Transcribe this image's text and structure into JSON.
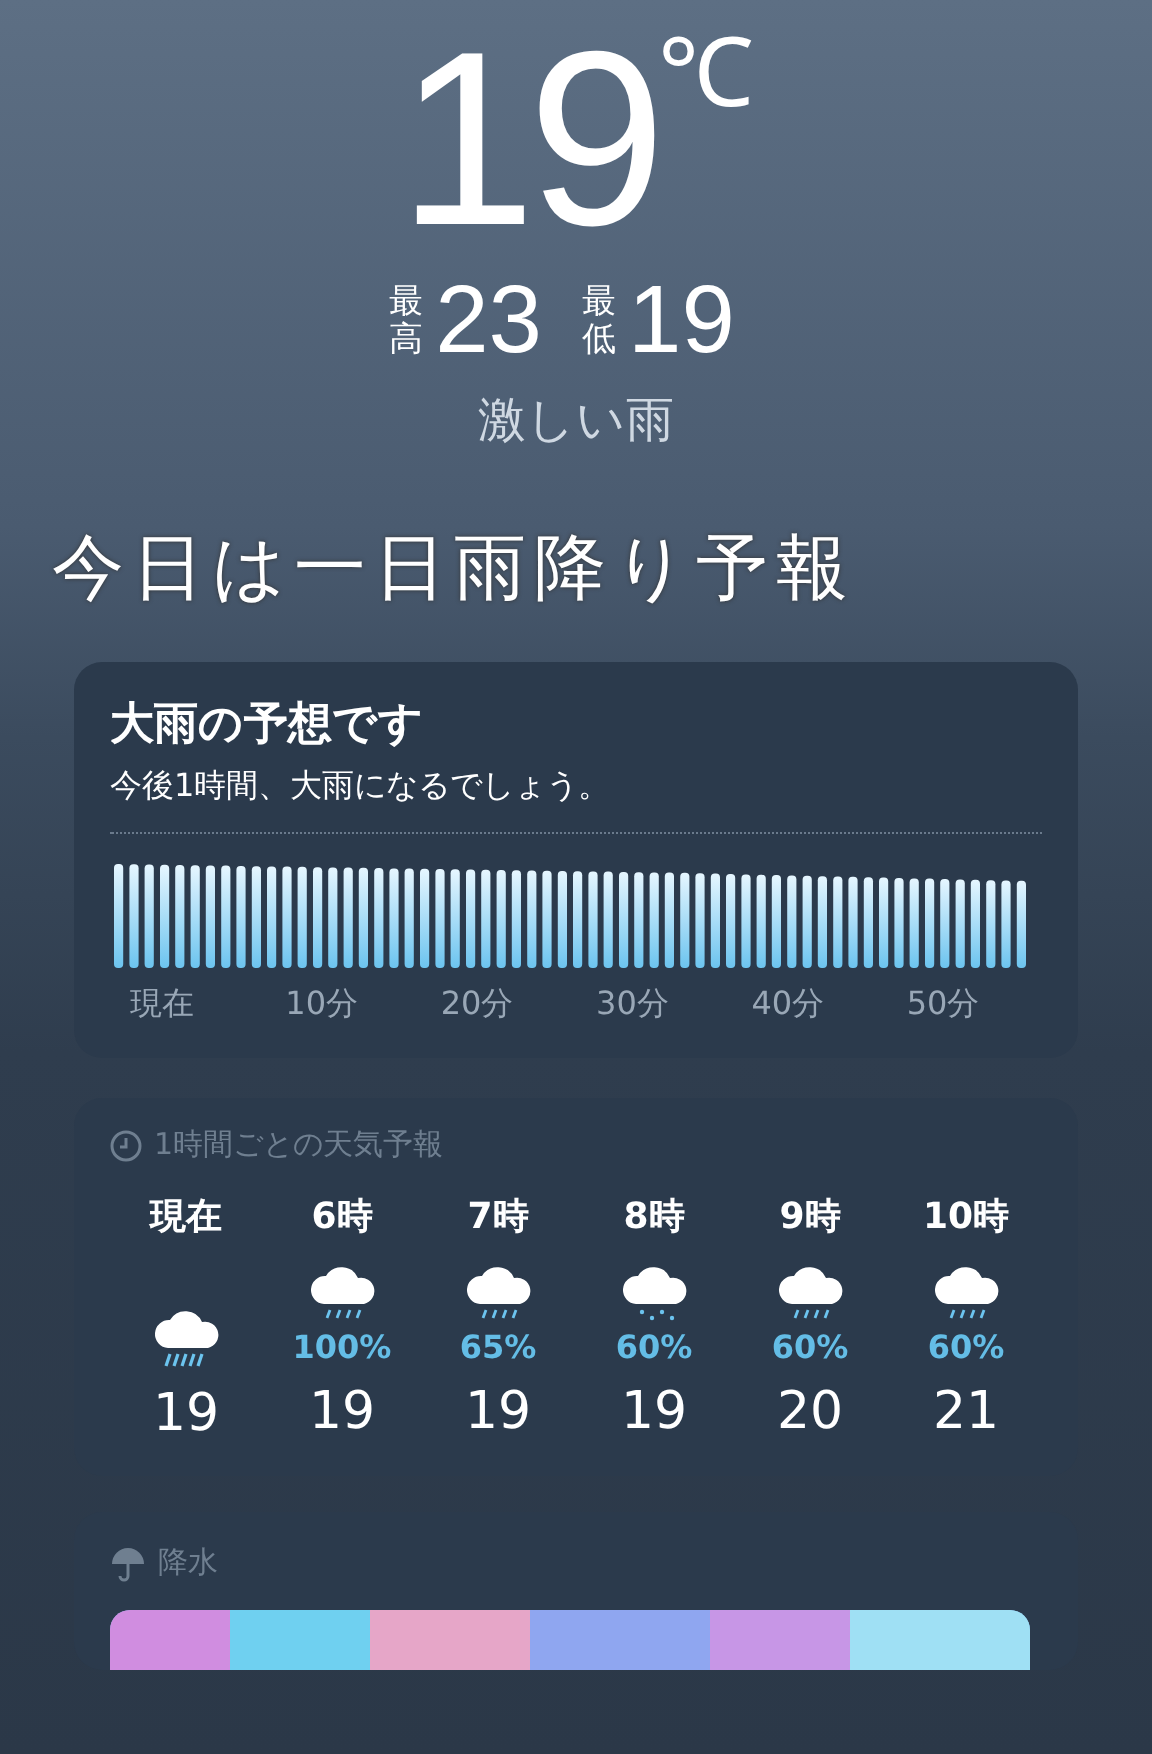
{
  "current": {
    "temperature": "19",
    "unit": "℃",
    "high_label": "最高",
    "high": "23",
    "low_label": "最低",
    "low": "19",
    "condition": "激しい雨"
  },
  "caption": "今日は一日雨降り予報",
  "next_hour": {
    "title": "大雨の予想です",
    "summary": "今後1時間、大雨になるでしょう。",
    "axis": [
      "現在",
      "10分",
      "20分",
      "30分",
      "40分",
      "50分"
    ]
  },
  "hourly": {
    "title": "1時間ごとの天気予報",
    "hours": [
      {
        "time": "現在",
        "kind": "heavy",
        "temp": "19"
      },
      {
        "time": "6時",
        "kind": "rain",
        "chance": "100%",
        "temp": "19"
      },
      {
        "time": "7時",
        "kind": "rain",
        "chance": "65%",
        "temp": "19"
      },
      {
        "time": "8時",
        "kind": "drizzle",
        "chance": "60%",
        "temp": "19"
      },
      {
        "time": "9時",
        "kind": "rain",
        "chance": "60%",
        "temp": "20"
      },
      {
        "time": "10時",
        "kind": "rain",
        "chance": "60%",
        "temp": "21"
      }
    ]
  },
  "precipitation": {
    "title": "降水"
  }
}
